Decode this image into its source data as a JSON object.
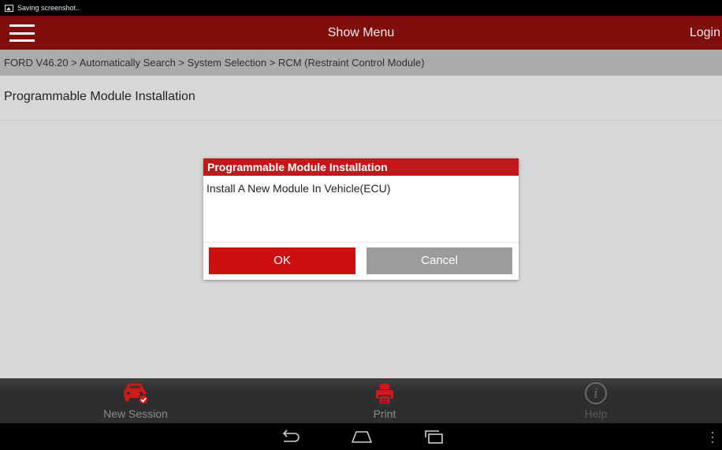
{
  "status_bar": {
    "text": "Saving screenshot..",
    "icon": "image-icon"
  },
  "app_bar": {
    "menu_icon": "hamburger-menu-icon",
    "title": "Show Menu",
    "login_label": "Login"
  },
  "breadcrumb": "FORD V46.20 > Automatically Search > System Selection > RCM (Restraint Control Module)",
  "page": {
    "title": "Programmable Module Installation"
  },
  "dialog": {
    "title": "Programmable Module Installation",
    "message": "Install A New Module In Vehicle(ECU)",
    "ok_label": "OK",
    "cancel_label": "Cancel"
  },
  "toolbar": {
    "new_session": {
      "label": "New Session",
      "icon": "car-check-icon"
    },
    "print": {
      "label": "Print",
      "icon": "printer-icon"
    },
    "help": {
      "label": "Help",
      "icon": "info-icon"
    }
  },
  "nav": {
    "back_icon": "back-icon",
    "home_icon": "home-icon",
    "recent_icon": "recent-apps-icon",
    "overflow_icon": "overflow-menu-icon"
  },
  "colors": {
    "app_bar": "#800e0d",
    "accent_red": "#cc1011",
    "dialog_header": "#c0191b",
    "cancel_gray": "#9c9c9c"
  }
}
